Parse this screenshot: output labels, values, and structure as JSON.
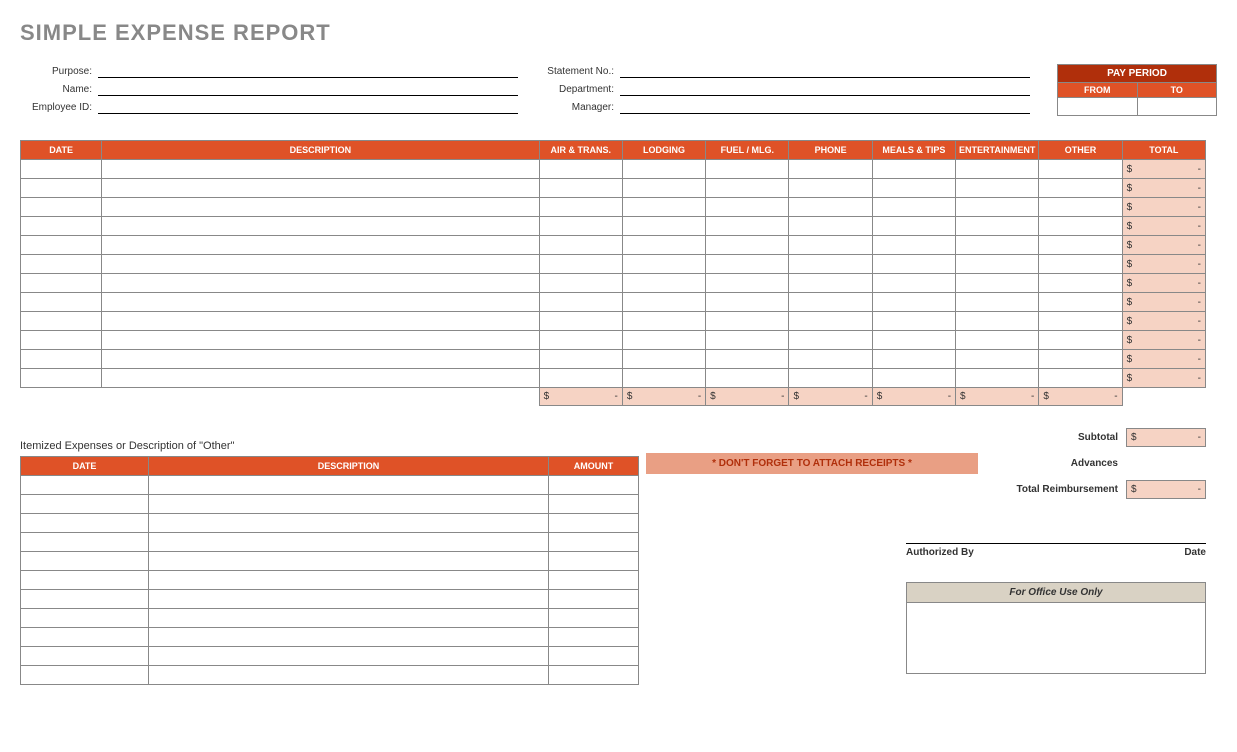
{
  "title": "SIMPLE EXPENSE REPORT",
  "fields": {
    "purpose_label": "Purpose:",
    "name_label": "Name:",
    "employee_id_label": "Employee ID:",
    "statement_no_label": "Statement No.:",
    "department_label": "Department:",
    "manager_label": "Manager:",
    "purpose": "",
    "name": "",
    "employee_id": "",
    "statement_no": "",
    "department": "",
    "manager": ""
  },
  "pay_period": {
    "title": "PAY PERIOD",
    "from_label": "FROM",
    "to_label": "TO",
    "from": "",
    "to": ""
  },
  "headers": {
    "date": "DATE",
    "description": "DESCRIPTION",
    "air": "AIR & TRANS.",
    "lodging": "LODGING",
    "fuel": "FUEL / MLG.",
    "phone": "PHONE",
    "meals": "MEALS & TIPS",
    "ent": "ENTERTAINMENT",
    "other": "OTHER",
    "total": "TOTAL",
    "amount": "AMOUNT"
  },
  "money": {
    "sym": "$",
    "dash": "-"
  },
  "main_rows": 12,
  "receipts_note": "* DON'T FORGET TO ATTACH RECEIPTS *",
  "summary": {
    "subtotal_label": "Subtotal",
    "advances_label": "Advances",
    "reimb_label": "Total Reimbursement",
    "subtotal": "",
    "advances": "",
    "reimb": ""
  },
  "itemized_title": "Itemized Expenses or Description of \"Other\"",
  "itemized_rows": 11,
  "signature": {
    "authorized_label": "Authorized By",
    "date_label": "Date"
  },
  "office": {
    "title": "For Office Use Only"
  }
}
